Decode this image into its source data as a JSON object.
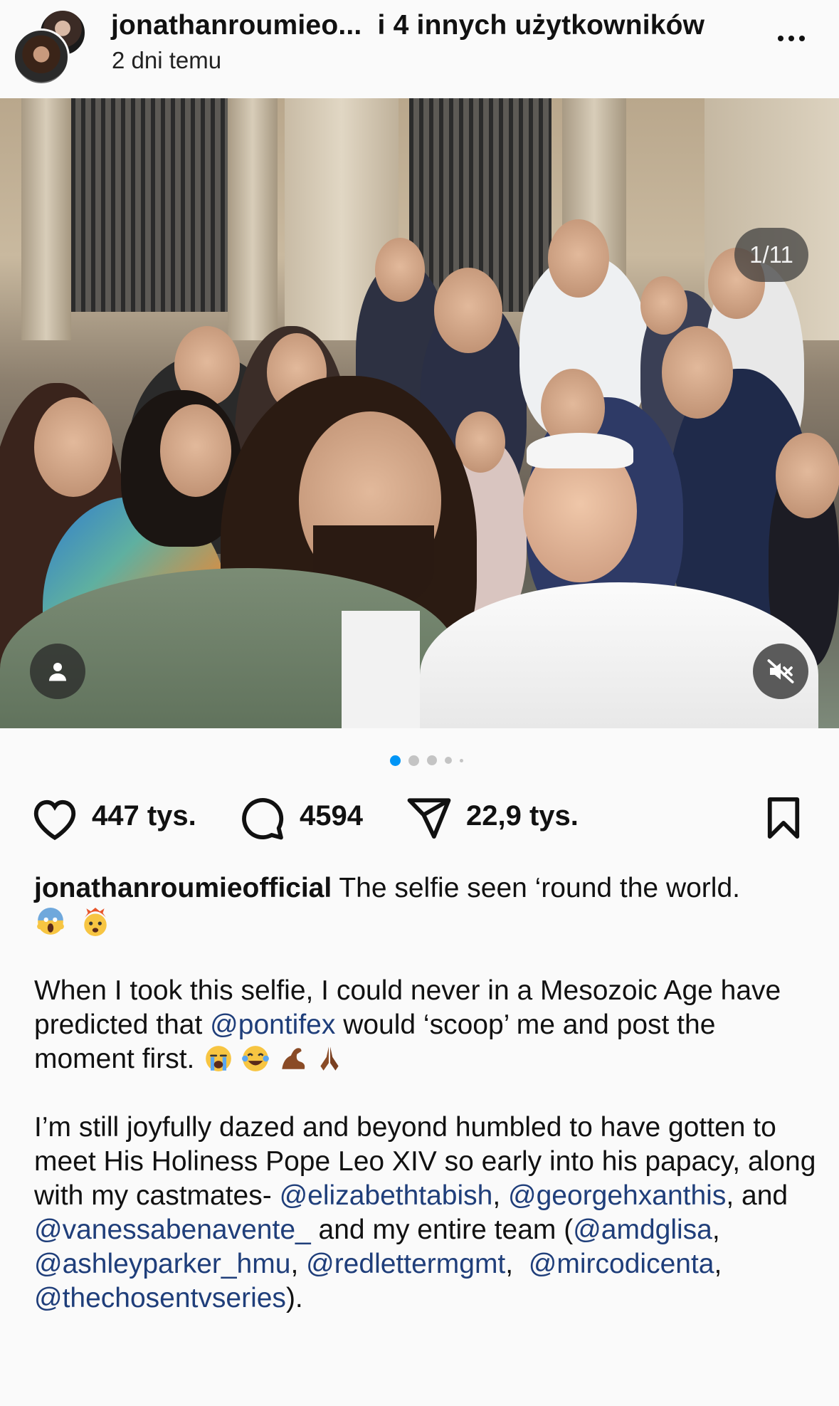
{
  "header": {
    "username": "jonathanroumieo...",
    "others": "i 4 innych użytkowników",
    "time_ago": "2 dni temu",
    "more_icon": "more-horizontal-icon"
  },
  "media": {
    "counter": "1/11",
    "tag_icon": "person-tag-icon",
    "mute_icon": "muted-speaker-icon",
    "carousel_dots": 5,
    "active_dot": 0
  },
  "actions": {
    "likes": "447 tys.",
    "comments": "4594",
    "shares": "22,9 tys.",
    "like_icon": "heart-icon",
    "comment_icon": "comment-bubble-icon",
    "share_icon": "send-icon",
    "save_icon": "bookmark-icon"
  },
  "caption": {
    "username": "jonathanroumieofficial",
    "line1": " The selfie seen ‘round the world.",
    "emoji1": [
      "face-screaming-emoji",
      "exploding-head-emoji"
    ],
    "p2_part1": "When I took this selfie, I could never in a Mesozoic Age have predicted that ",
    "p2_mention": "@pontifex",
    "p2_part2": " would ‘scoop’ me and post the moment first. ",
    "emoji2": [
      "loudly-crying-emoji",
      "tears-of-joy-emoji",
      "flexed-biceps-emoji",
      "folded-hands-emoji"
    ],
    "p3_part1": "I’m still joyfully dazed and beyond humbled to have gotten to meet His Holiness Pope Leo XIV so early into his papacy, along with my castmates- ",
    "m1": "@elizabethtabish",
    "sep1": ", ",
    "m2": "@georgehxanthis",
    "sep2": ", and ",
    "m3": "@vanessabenavente_",
    "sep3": " and my entire team (",
    "m4": "@amdglisa",
    "sep4": ", ",
    "m5": "@ashleyparker_hmu",
    "sep5": ", ",
    "m6": "@redlettermgmt",
    "sep6": ",  ",
    "m7": "@mircodicenta",
    "sep7": ", ",
    "m8": "@thechosentvseries",
    "end": ")."
  },
  "colors": {
    "background": "#fafafa",
    "active_dot": "#0095f6",
    "mention": "#1f3e7a",
    "text": "#111111"
  }
}
